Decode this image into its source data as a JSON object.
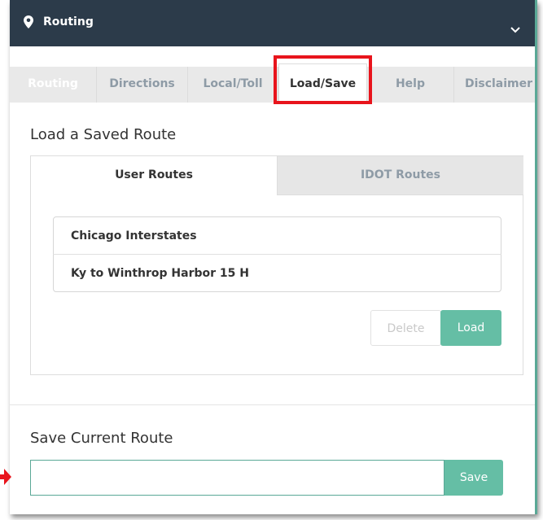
{
  "header": {
    "title": "Routing",
    "pin_icon": "map-pin-icon",
    "toggle_icon": "chevron-down-icon"
  },
  "tabs": [
    {
      "label": "Routing"
    },
    {
      "label": "Directions"
    },
    {
      "label": "Local/Toll"
    },
    {
      "label": "Load/Save",
      "active": true
    },
    {
      "label": "Help"
    },
    {
      "label": "Disclaimer"
    }
  ],
  "load_section": {
    "heading": "Load a Saved Route",
    "subtabs": {
      "user": "User Routes",
      "idot": "IDOT Routes"
    },
    "routes": [
      "Chicago Interstates",
      "Ky to Winthrop Harbor 15 H"
    ],
    "delete_label": "Delete",
    "load_label": "Load"
  },
  "save_section": {
    "heading": "Save Current Route",
    "input_value": "",
    "save_label": "Save"
  },
  "colors": {
    "header_bg": "#2c3b4a",
    "accent": "#65bea5",
    "highlight": "#e8141c"
  }
}
